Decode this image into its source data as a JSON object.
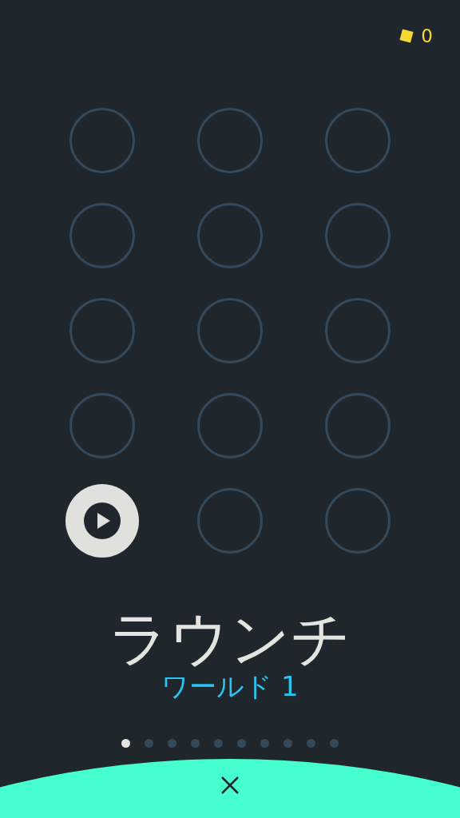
{
  "coins": {
    "count": "0"
  },
  "levels": [
    {
      "kind": "locked"
    },
    {
      "kind": "locked"
    },
    {
      "kind": "locked"
    },
    {
      "kind": "locked"
    },
    {
      "kind": "locked"
    },
    {
      "kind": "locked"
    },
    {
      "kind": "locked"
    },
    {
      "kind": "locked"
    },
    {
      "kind": "locked"
    },
    {
      "kind": "locked"
    },
    {
      "kind": "locked"
    },
    {
      "kind": "locked"
    },
    {
      "kind": "play"
    },
    {
      "kind": "locked"
    },
    {
      "kind": "locked"
    }
  ],
  "title": "ラウンチ",
  "subtitle": "ワールド 1",
  "pages": [
    {
      "selected": true
    },
    {
      "selected": false
    },
    {
      "selected": false
    },
    {
      "selected": false
    },
    {
      "selected": false
    },
    {
      "selected": false
    },
    {
      "selected": false
    },
    {
      "selected": false
    },
    {
      "selected": false
    },
    {
      "selected": false
    }
  ]
}
